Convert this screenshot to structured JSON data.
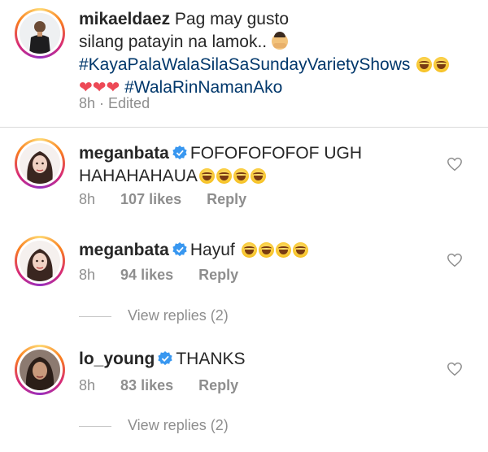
{
  "post": {
    "username": "mikaeldaez",
    "line1": "Pag may gusto",
    "line2": "silang patayin na lamok..",
    "hashtag1": "#KayaPalaWalaSilaSaSundayVarietyShows",
    "hashtag2": "#WalaRinNamanAko",
    "time": "8h",
    "edited": "· Edited"
  },
  "comments": [
    {
      "username": "meganbata",
      "text_line1": "FOFOFOFOFOF UGH",
      "text_line2": "HAHAHAHAUA",
      "time": "8h",
      "likes": "107 likes",
      "reply": "Reply"
    },
    {
      "username": "meganbata",
      "text_line1": "Hayuf",
      "time": "8h",
      "likes": "94 likes",
      "reply": "Reply",
      "view_replies": "View replies (2)"
    },
    {
      "username": "lo_young",
      "text_line1": "THANKS",
      "time": "8h",
      "likes": "83 likes",
      "reply": "Reply",
      "view_replies": "View replies (2)"
    }
  ],
  "colors": {
    "verified": "#3897f0",
    "hashtag": "#00376b",
    "meta": "#8e8e8e",
    "heart": "#ed4956"
  }
}
